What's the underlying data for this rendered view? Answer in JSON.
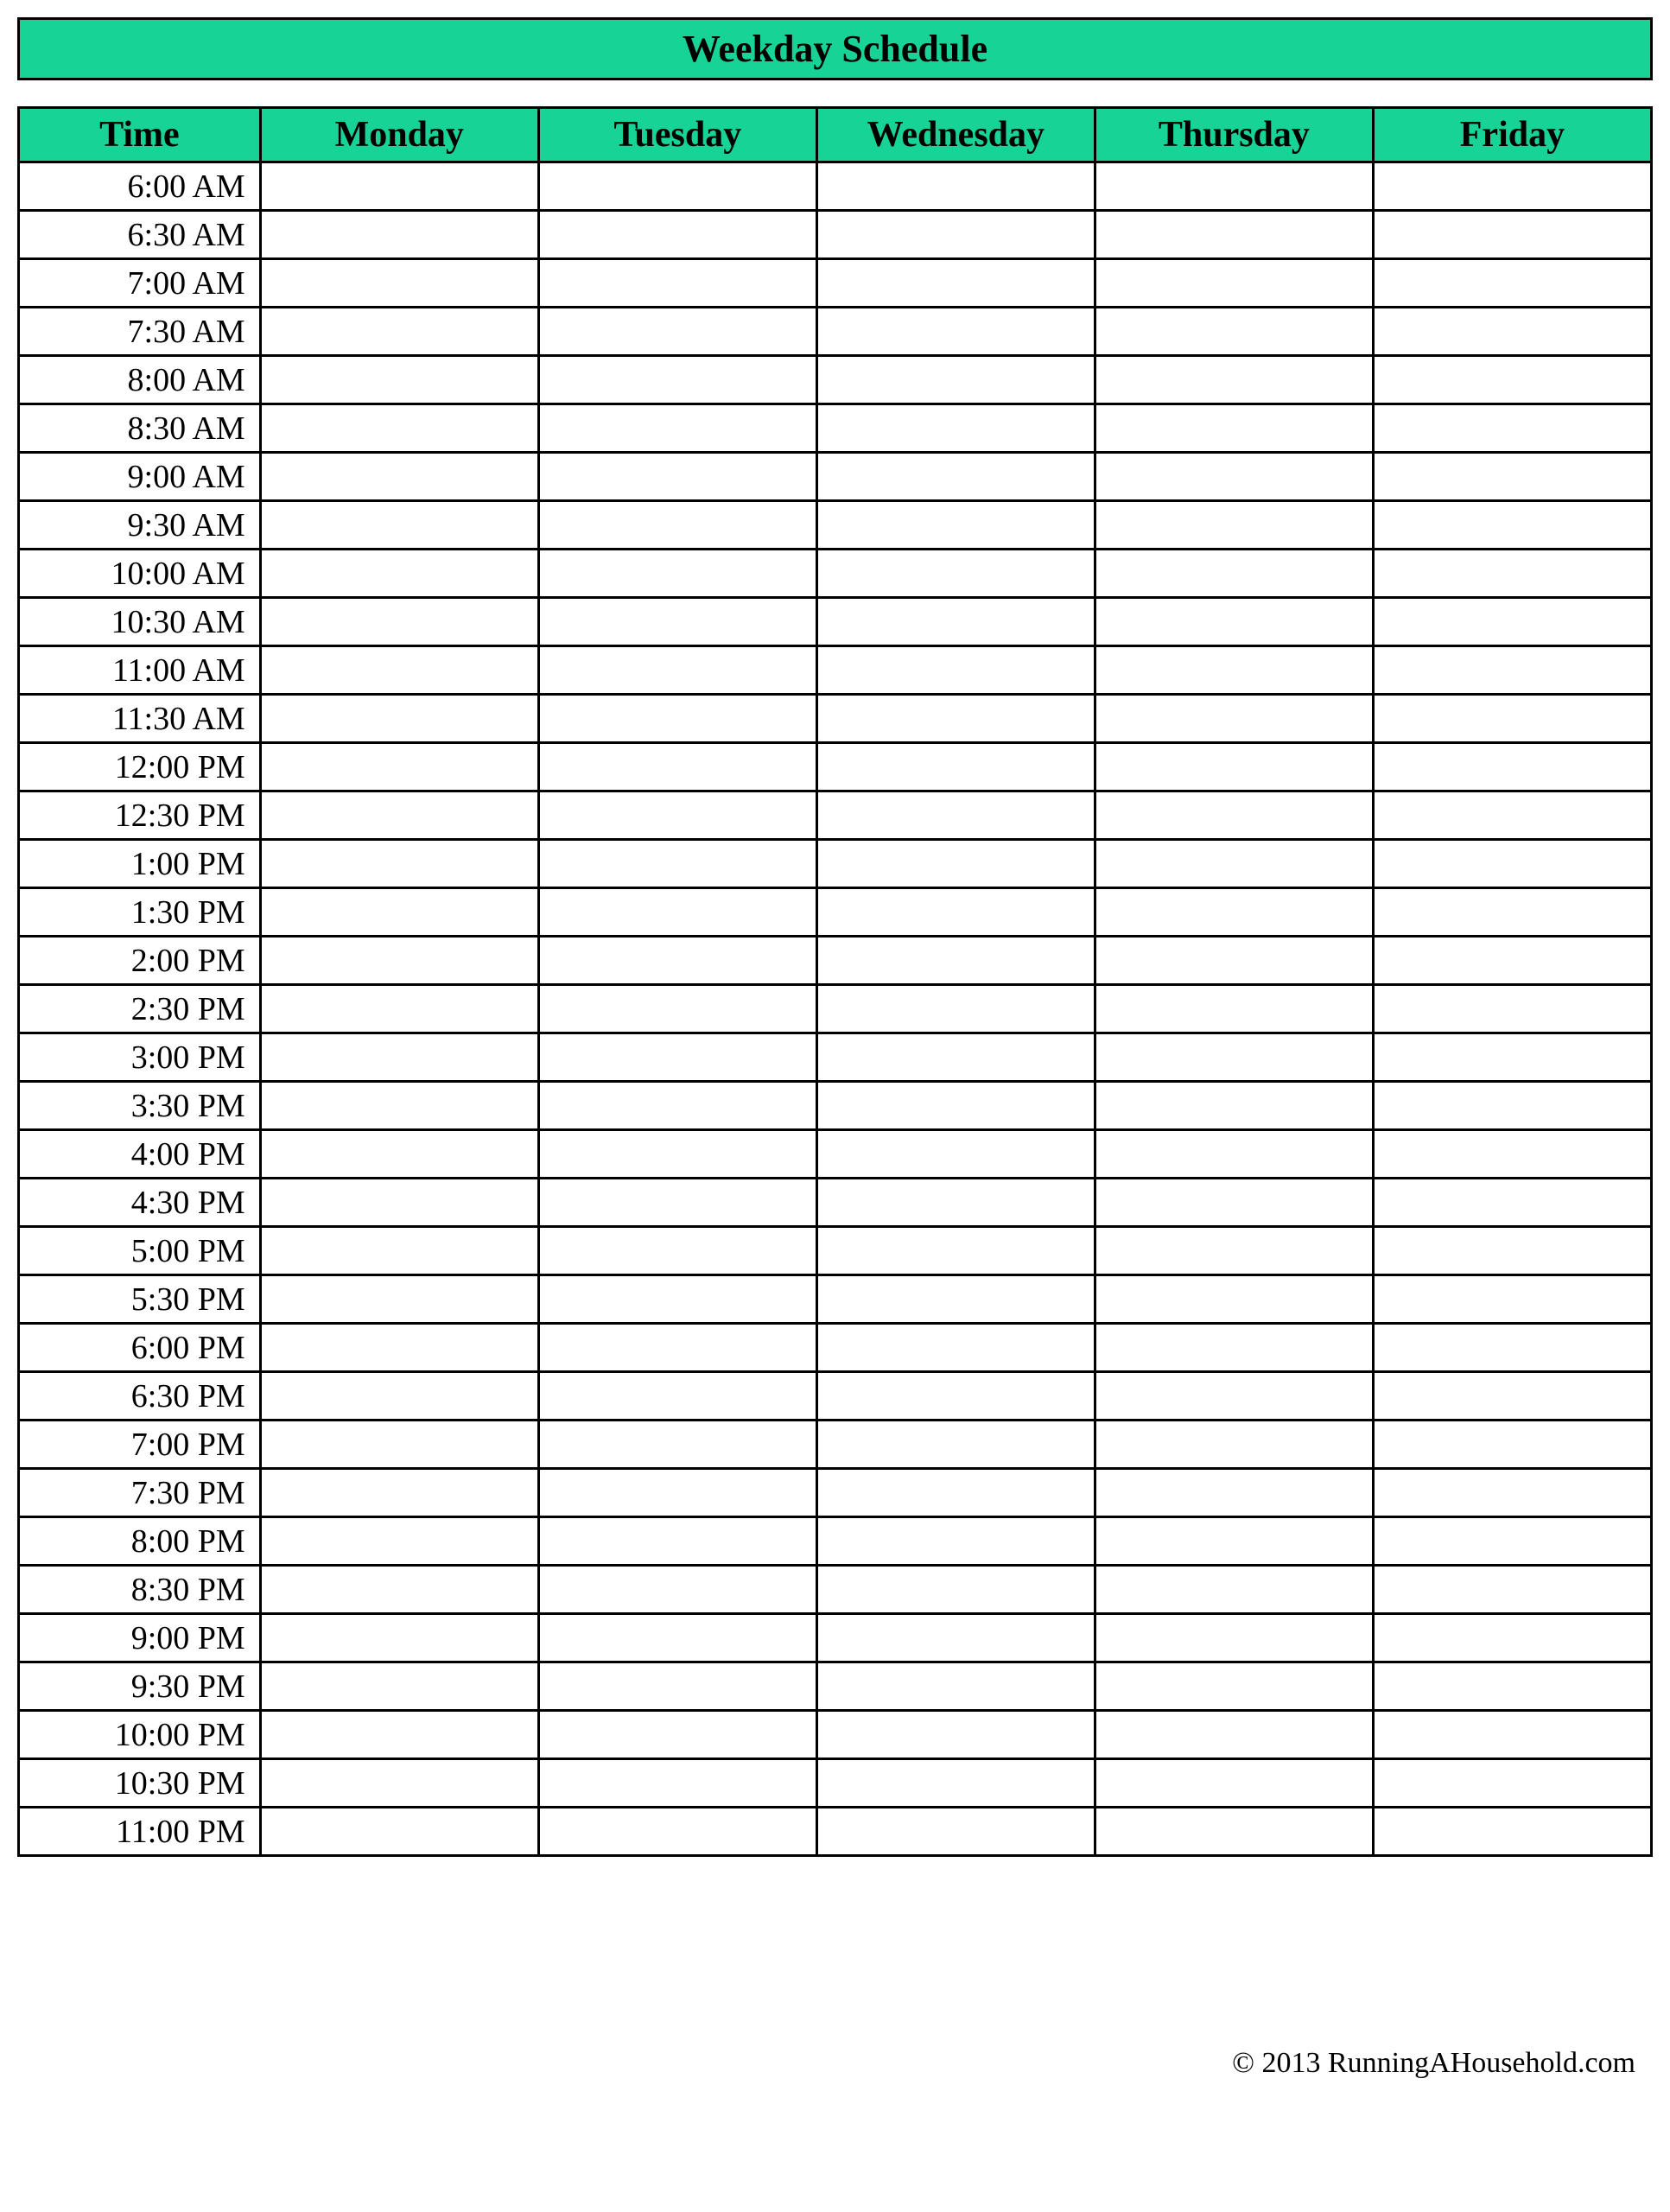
{
  "title": "Weekday Schedule",
  "columns": [
    "Time",
    "Monday",
    "Tuesday",
    "Wednesday",
    "Thursday",
    "Friday"
  ],
  "times": [
    "6:00 AM",
    "6:30 AM",
    "7:00 AM",
    "7:30 AM",
    "8:00 AM",
    "8:30 AM",
    "9:00 AM",
    "9:30 AM",
    "10:00 AM",
    "10:30 AM",
    "11:00 AM",
    "11:30 AM",
    "12:00 PM",
    "12:30 PM",
    "1:00 PM",
    "1:30 PM",
    "2:00 PM",
    "2:30 PM",
    "3:00 PM",
    "3:30 PM",
    "4:00 PM",
    "4:30 PM",
    "5:00 PM",
    "5:30 PM",
    "6:00 PM",
    "6:30 PM",
    "7:00 PM",
    "7:30 PM",
    "8:00 PM",
    "8:30 PM",
    "9:00 PM",
    "9:30 PM",
    "10:00 PM",
    "10:30 PM",
    "11:00 PM"
  ],
  "footer": "© 2013 RunningAHousehold.com"
}
